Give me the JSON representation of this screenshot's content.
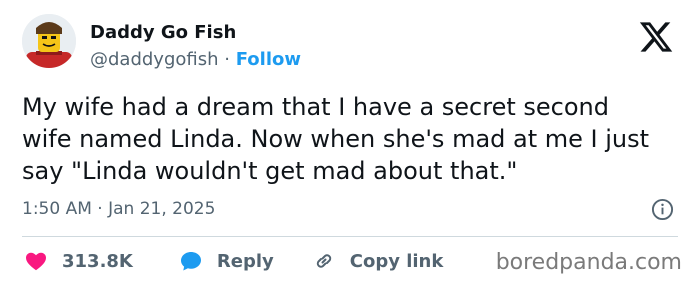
{
  "author": {
    "display_name": "Daddy Go Fish",
    "handle": "@daddygofish",
    "separator": "·",
    "follow_label": "Follow",
    "avatar_icon": "lego-minifigure-avatar"
  },
  "platform_logo": "x-logo-icon",
  "tweet": {
    "text": "My wife had a dream that I have a secret second wife named Linda. Now when she's mad at me I just say \"Linda wouldn't get mad about that.\"",
    "timestamp": "1:50 AM · Jan 21, 2025"
  },
  "actions": {
    "likes": "313.8K",
    "reply_label": "Reply",
    "copy_link_label": "Copy link"
  },
  "colors": {
    "accent": "#1d9bf0",
    "like": "#f91880",
    "muted": "#536471",
    "text": "#0f1419"
  },
  "watermark": "boredpanda.com"
}
